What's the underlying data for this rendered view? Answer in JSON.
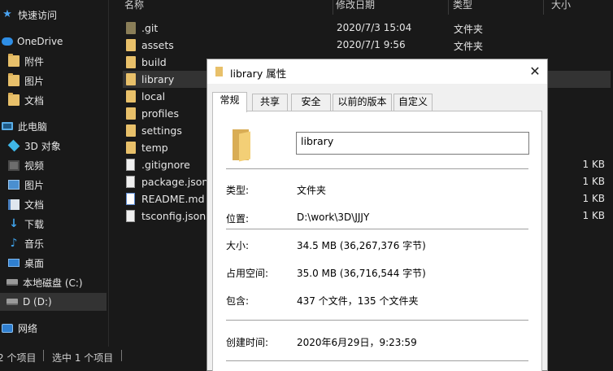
{
  "nav": {
    "items": [
      {
        "label": "快速访问",
        "icon": "star-icon"
      },
      {
        "label": "OneDrive",
        "icon": "cloud-icon"
      },
      {
        "label": "附件",
        "icon": "folder-icon"
      },
      {
        "label": "图片",
        "icon": "folder-icon"
      },
      {
        "label": "文档",
        "icon": "folder-icon"
      },
      {
        "label": "此电脑",
        "icon": "computer-icon"
      },
      {
        "label": "3D 对象",
        "icon": "3d-objects-icon"
      },
      {
        "label": "视频",
        "icon": "video-icon"
      },
      {
        "label": "图片",
        "icon": "pictures-icon"
      },
      {
        "label": "文档",
        "icon": "documents-icon"
      },
      {
        "label": "下载",
        "icon": "download-icon"
      },
      {
        "label": "音乐",
        "icon": "music-icon"
      },
      {
        "label": "桌面",
        "icon": "desktop-icon"
      },
      {
        "label": "本地磁盘 (C:)",
        "icon": "drive-icon"
      },
      {
        "label": "D (D:)",
        "icon": "drive-icon",
        "selected": true
      },
      {
        "label": "网络",
        "icon": "network-icon"
      }
    ]
  },
  "columns": {
    "name": "名称",
    "date": "修改日期",
    "type": "类型",
    "size": "大小"
  },
  "files": [
    {
      "name": ".git",
      "date": "2020/7/3 15:04",
      "type": "文件夹",
      "size": "",
      "icon": "folder-icon"
    },
    {
      "name": "assets",
      "date": "2020/7/1 9:56",
      "type": "文件夹",
      "size": "",
      "icon": "folder-icon"
    },
    {
      "name": "build",
      "date": "",
      "type": "",
      "size": "",
      "icon": "folder-icon"
    },
    {
      "name": "library",
      "date": "",
      "type": "",
      "size": "",
      "icon": "folder-icon",
      "selected": true
    },
    {
      "name": "local",
      "date": "",
      "type": "",
      "size": "",
      "icon": "folder-icon"
    },
    {
      "name": "profiles",
      "date": "",
      "type": "",
      "size": "",
      "icon": "folder-icon"
    },
    {
      "name": "settings",
      "date": "",
      "type": "",
      "size": "",
      "icon": "folder-icon"
    },
    {
      "name": "temp",
      "date": "",
      "type": "",
      "size": "",
      "icon": "folder-icon"
    },
    {
      "name": ".gitignore",
      "date": "",
      "type": "",
      "size": "1 KB",
      "icon": "file-icon"
    },
    {
      "name": "package.json",
      "date": "",
      "type": "",
      "size": "1 KB",
      "icon": "file-icon"
    },
    {
      "name": "README.md",
      "date": "",
      "type": "",
      "size": "1 KB",
      "icon": "markdown-file-icon"
    },
    {
      "name": "tsconfig.json",
      "date": "",
      "type": "",
      "size": "1 KB",
      "icon": "file-icon"
    }
  ],
  "status": {
    "count": "2 个项目",
    "selected": "选中 1 个项目"
  },
  "dialog": {
    "title": "library 属性",
    "tabs": [
      "常规",
      "共享",
      "安全",
      "以前的版本",
      "自定义"
    ],
    "name_value": "library",
    "props": [
      {
        "label": "类型:",
        "value": "文件夹"
      },
      {
        "label": "位置:",
        "value": "D:\\work\\3D\\JJJY"
      },
      {
        "label": "大小:",
        "value": "34.5 MB (36,267,376 字节)"
      },
      {
        "label": "占用空间:",
        "value": "35.0 MB (36,716,544 字节)"
      },
      {
        "label": "包含:",
        "value": "437 个文件，135 个文件夹"
      },
      {
        "label": "创建时间:",
        "value": "2020年6月29日，9:23:59"
      }
    ]
  },
  "colors": {
    "background": "#191919",
    "selection": "#333333",
    "dialog": "#f0f0f0",
    "folder": "#e8c06a",
    "accent": "#2e8ee6"
  }
}
